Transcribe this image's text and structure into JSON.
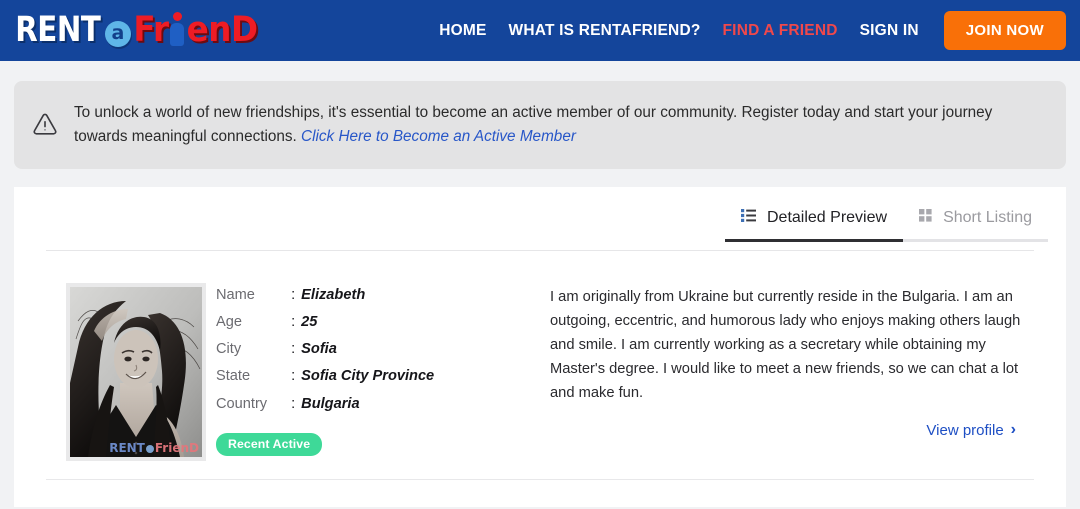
{
  "header": {
    "logo": {
      "part1": "RENT",
      "circle": "a",
      "part2": "Fr",
      "part3": "enD",
      "alt": "RentAFriend"
    },
    "nav": [
      {
        "label": "HOME",
        "accent": false
      },
      {
        "label": "WHAT IS RENTAFRIEND?",
        "accent": false
      },
      {
        "label": "FIND A FRIEND",
        "accent": true
      },
      {
        "label": "SIGN IN",
        "accent": false
      }
    ],
    "join_label": "JOIN NOW",
    "bg_color": "#14459b",
    "accent_color": "#f0484b",
    "join_color": "#f97008"
  },
  "banner": {
    "icon": "warning-triangle-icon",
    "text": "To unlock a world of new friendships, it's essential to become an active member of our community. Register today and start your journey towards meaningful connections.",
    "link_text": "Click Here to Become an Active Member",
    "bg_color": "#e3e3e4",
    "link_color": "#2857c8"
  },
  "tabs": [
    {
      "label": "Detailed Preview",
      "icon": "list-icon",
      "active": true
    },
    {
      "label": "Short Listing",
      "icon": "grid-icon",
      "active": false
    }
  ],
  "profile": {
    "photo_alt": "Elizabeth profile photo",
    "watermark": {
      "part1": "RENT",
      "part2": "Fri",
      "part3": "enD"
    },
    "fields": [
      {
        "label": "Name",
        "separator": ":",
        "value": "Elizabeth"
      },
      {
        "label": "Age",
        "separator": ":",
        "value": "25"
      },
      {
        "label": "City",
        "separator": ":",
        "value": "Sofia"
      },
      {
        "label": "State",
        "separator": ":",
        "value": "Sofia City Province"
      },
      {
        "label": "Country",
        "separator": ":",
        "value": "Bulgaria"
      }
    ],
    "badge": {
      "label": "Recent Active",
      "color": "#3ed998"
    },
    "description": "I am originally from Ukraine but currently reside in the Bulgaria. I am an outgoing, eccentric, and humorous lady who enjoys making others laugh and smile. I am currently working as a secretary while obtaining my Master's degree. I would like to meet a new friends, so we can chat a lot and make fun.",
    "view_profile_label": "View profile",
    "view_profile_chevron": "›",
    "view_profile_color": "#1e4fc4"
  }
}
